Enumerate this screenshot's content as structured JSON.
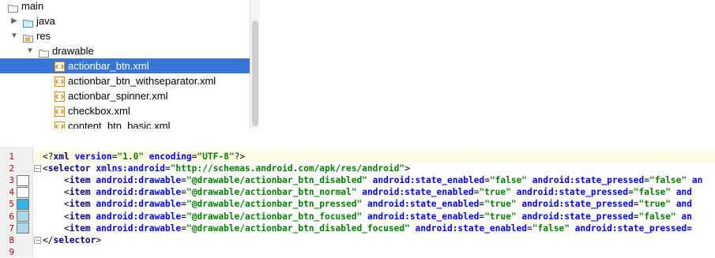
{
  "tree": {
    "items": [
      {
        "label": "main",
        "icon": "folder-icon",
        "indent": 0,
        "arrow": "none"
      },
      {
        "label": "java",
        "icon": "source-folder-icon",
        "indent": 1,
        "arrow": "collapsed"
      },
      {
        "label": "res",
        "icon": "resource-folder-icon",
        "indent": 1,
        "arrow": "expanded"
      },
      {
        "label": "drawable",
        "icon": "folder-icon",
        "indent": 2,
        "arrow": "expanded"
      },
      {
        "label": "actionbar_btn.xml",
        "icon": "xml-file-icon",
        "indent": 3,
        "arrow": "none",
        "selected": true
      },
      {
        "label": "actionbar_btn_withseparator.xml",
        "icon": "xml-file-icon",
        "indent": 3,
        "arrow": "none"
      },
      {
        "label": "actionbar_spinner.xml",
        "icon": "xml-file-icon",
        "indent": 3,
        "arrow": "none"
      },
      {
        "label": "checkbox.xml",
        "icon": "xml-file-icon",
        "indent": 3,
        "arrow": "none"
      },
      {
        "label": "content_btn_basic.xml",
        "icon": "xml-file-icon",
        "indent": 3,
        "arrow": "none"
      }
    ]
  },
  "editor": {
    "lines": [
      {
        "num": "1",
        "swatch": null,
        "fold": null,
        "tokens": [
          [
            "p",
            "<?"
          ],
          [
            "tag",
            "xml "
          ],
          [
            "attr",
            "version"
          ],
          [
            "p",
            "="
          ],
          [
            "val",
            "\"1.0\""
          ],
          [
            "p",
            " "
          ],
          [
            "attr",
            "encoding"
          ],
          [
            "p",
            "="
          ],
          [
            "val",
            "\"UTF-8\""
          ],
          [
            "p",
            "?>"
          ]
        ]
      },
      {
        "num": "2",
        "swatch": null,
        "fold": "open",
        "tokens": [
          [
            "p",
            "<"
          ],
          [
            "tag",
            "selector "
          ],
          [
            "attr",
            "xmlns:android"
          ],
          [
            "p",
            "="
          ],
          [
            "val",
            "\"http://schemas.android.com/apk/res/android\""
          ],
          [
            "p",
            ">"
          ]
        ]
      },
      {
        "num": "3",
        "swatch": "#f8fafa",
        "fold": null,
        "tokens": [
          [
            "p",
            "    <"
          ],
          [
            "tag",
            "item "
          ],
          [
            "attr",
            "android:drawable"
          ],
          [
            "p",
            "="
          ],
          [
            "val",
            "\"@drawable/actionbar_btn_disabled\""
          ],
          [
            "p",
            " "
          ],
          [
            "attr",
            "android:state_enabled"
          ],
          [
            "p",
            "="
          ],
          [
            "val",
            "\"false\""
          ],
          [
            "p",
            " "
          ],
          [
            "attr",
            "android:state_pressed"
          ],
          [
            "p",
            "="
          ],
          [
            "val",
            "\"false\""
          ],
          [
            "p",
            " "
          ],
          [
            "attr",
            "an"
          ]
        ]
      },
      {
        "num": "4",
        "swatch": "#f8fafa",
        "fold": null,
        "tokens": [
          [
            "p",
            "    <"
          ],
          [
            "tag",
            "item "
          ],
          [
            "attr",
            "android:drawable"
          ],
          [
            "p",
            "="
          ],
          [
            "val",
            "\"@drawable/actionbar_btn_normal\""
          ],
          [
            "p",
            " "
          ],
          [
            "attr",
            "android:state_enabled"
          ],
          [
            "p",
            "="
          ],
          [
            "val",
            "\"true\""
          ],
          [
            "p",
            " "
          ],
          [
            "attr",
            "android:state_pressed"
          ],
          [
            "p",
            "="
          ],
          [
            "val",
            "\"false\""
          ],
          [
            "p",
            " "
          ],
          [
            "attr",
            "and"
          ]
        ]
      },
      {
        "num": "5",
        "swatch": "#33b5e5",
        "fold": null,
        "tokens": [
          [
            "p",
            "    <"
          ],
          [
            "tag",
            "item "
          ],
          [
            "attr",
            "android:drawable"
          ],
          [
            "p",
            "="
          ],
          [
            "val",
            "\"@drawable/actionbar_btn_pressed\""
          ],
          [
            "p",
            " "
          ],
          [
            "attr",
            "android:state_enabled"
          ],
          [
            "p",
            "="
          ],
          [
            "val",
            "\"true\""
          ],
          [
            "p",
            " "
          ],
          [
            "attr",
            "android:state_pressed"
          ],
          [
            "p",
            "="
          ],
          [
            "val",
            "\"true\""
          ],
          [
            "p",
            " "
          ],
          [
            "attr",
            "and"
          ]
        ]
      },
      {
        "num": "6",
        "swatch": "#aad8ea",
        "fold": null,
        "tokens": [
          [
            "p",
            "    <"
          ],
          [
            "tag",
            "item "
          ],
          [
            "attr",
            "android:drawable"
          ],
          [
            "p",
            "="
          ],
          [
            "val",
            "\"@drawable/actionbar_btn_focused\""
          ],
          [
            "p",
            " "
          ],
          [
            "attr",
            "android:state_enabled"
          ],
          [
            "p",
            "="
          ],
          [
            "val",
            "\"true\""
          ],
          [
            "p",
            " "
          ],
          [
            "attr",
            "android:state_pressed"
          ],
          [
            "p",
            "="
          ],
          [
            "val",
            "\"false\""
          ],
          [
            "p",
            " "
          ],
          [
            "attr",
            "an"
          ]
        ]
      },
      {
        "num": "7",
        "swatch": "#aad8ea",
        "fold": null,
        "tokens": [
          [
            "p",
            "    <"
          ],
          [
            "tag",
            "item "
          ],
          [
            "attr",
            "android:drawable"
          ],
          [
            "p",
            "="
          ],
          [
            "val",
            "\"@drawable/actionbar_btn_disabled_focused\""
          ],
          [
            "p",
            " "
          ],
          [
            "attr",
            "android:state_enabled"
          ],
          [
            "p",
            "="
          ],
          [
            "val",
            "\"false\""
          ],
          [
            "p",
            " "
          ],
          [
            "attr",
            "android:state_pressed="
          ]
        ]
      },
      {
        "num": "8",
        "swatch": null,
        "fold": "close",
        "tokens": [
          [
            "p",
            "</"
          ],
          [
            "tag",
            "selector"
          ],
          [
            "p",
            ">"
          ]
        ]
      },
      {
        "num": "9",
        "swatch": null,
        "fold": null,
        "tokens": []
      }
    ]
  }
}
